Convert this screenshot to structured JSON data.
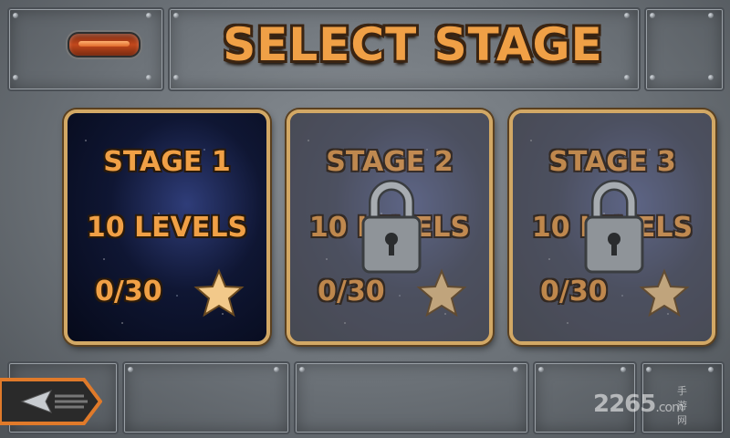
{
  "header": {
    "title": "SELECT STAGE",
    "menu_icon": "menu-pill-icon"
  },
  "stages": [
    {
      "name": "STAGE 1",
      "levels": "10 LEVELS",
      "progress": "0/30",
      "locked": false
    },
    {
      "name": "STAGE 2",
      "levels": "10 LEVELS",
      "progress": "0/30",
      "locked": true
    },
    {
      "name": "STAGE 3",
      "levels": "10 LEVELS",
      "progress": "0/30",
      "locked": true
    }
  ],
  "footer": {
    "back_icon": "back-arrow-icon",
    "watermark_brand": "2265",
    "watermark_domain": ".com",
    "watermark_cn": "手游网"
  },
  "colors": {
    "title_orange": "#f0a046",
    "card_border": "#d2a865",
    "menu_orange": "#c2481c"
  }
}
